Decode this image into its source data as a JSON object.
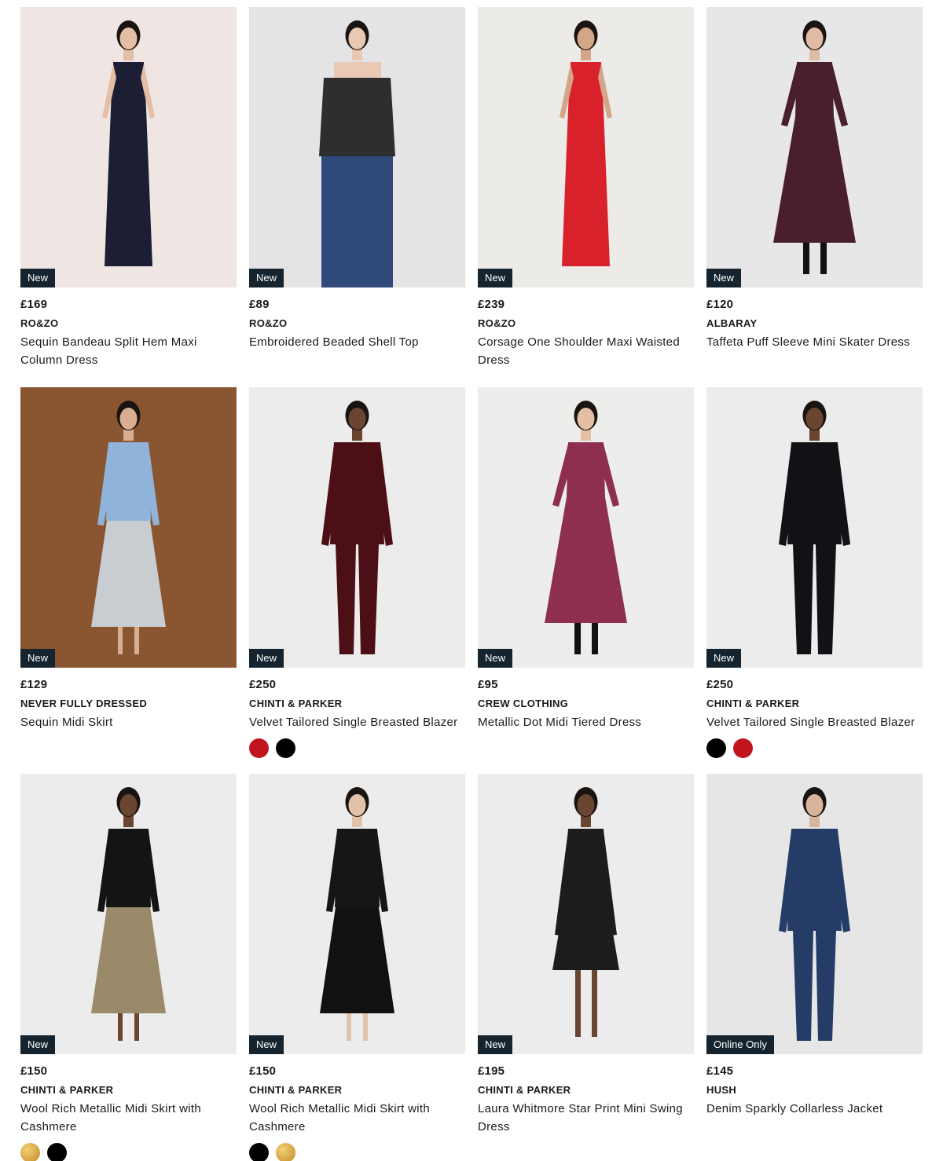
{
  "products": [
    {
      "badge": "New",
      "price": "£169",
      "brand": "RO&ZO",
      "title": "Sequin Bandeau Split Hem Maxi Column Dress",
      "bg": "#efe6e4",
      "garment": "#1c1e33",
      "skin": "#e5bea6",
      "style": "gown",
      "swatches": []
    },
    {
      "badge": "New",
      "price": "£89",
      "brand": "RO&ZO",
      "title": "Embroidered Beaded Shell Top",
      "bg": "#e4e4e6",
      "garment": "#2c2e30",
      "skin": "#eac9b4",
      "style": "top",
      "swatches": []
    },
    {
      "badge": "New",
      "price": "£239",
      "brand": "RO&ZO",
      "title": "Corsage One Shoulder Maxi Waisted Dress",
      "bg": "#ecebe8",
      "garment": "#d8212b",
      "skin": "#d4a688",
      "style": "gown",
      "swatches": []
    },
    {
      "badge": "New",
      "price": "£120",
      "brand": "ALBARAY",
      "title": "Taffeta Puff Sleeve Mini Skater Dress",
      "bg": "#e7e6e8",
      "garment": "#4a1f2c",
      "skin": "#e1bba3",
      "style": "dress",
      "swatches": []
    },
    {
      "badge": "New",
      "price": "£129",
      "brand": "NEVER FULLY DRESSED",
      "title": "Sequin Midi Skirt",
      "bg": "#8a5631",
      "garment": "#c8cdd2",
      "skin": "#d8ad91",
      "style": "skirt",
      "top": "#8fb3d9",
      "swatches": []
    },
    {
      "badge": "New",
      "price": "£250",
      "brand": "CHINTI & PARKER",
      "title": "Velvet Tailored Single Breasted Blazer",
      "bg": "#ececec",
      "garment": "#4c0f16",
      "skin": "#6a4632",
      "style": "suit",
      "swatches": [
        "#c0141f",
        "#000000"
      ]
    },
    {
      "badge": "New",
      "price": "£95",
      "brand": "CREW CLOTHING",
      "title": "Metallic Dot Midi Tiered Dress",
      "bg": "#ededeb",
      "garment": "#8e2f52",
      "skin": "#e4bfa5",
      "style": "dress",
      "swatches": []
    },
    {
      "badge": "New",
      "price": "£250",
      "brand": "CHINTI & PARKER",
      "title": "Velvet Tailored Single Breasted Blazer",
      "bg": "#ececec",
      "garment": "#121216",
      "skin": "#6a4632",
      "style": "suit",
      "swatches": [
        "#000000",
        "#c0141f"
      ]
    },
    {
      "badge": "New",
      "price": "£150",
      "brand": "CHINTI & PARKER",
      "title": "Wool Rich Metallic Midi Skirt with Cashmere",
      "bg": "#ececec",
      "garment": "#9b8a6a",
      "skin": "#6a4632",
      "style": "skirt",
      "top": "#141414",
      "swatches": [
        "#d4a23c",
        "#000000"
      ]
    },
    {
      "badge": "New",
      "price": "£150",
      "brand": "CHINTI & PARKER",
      "title": "Wool Rich Metallic Midi Skirt with Cashmere",
      "bg": "#ececec",
      "garment": "#111111",
      "skin": "#e3c2aa",
      "style": "skirt",
      "top": "#161616",
      "swatches": [
        "#000000",
        "#d4a23c"
      ]
    },
    {
      "badge": "New",
      "price": "£195",
      "brand": "CHINTI & PARKER",
      "title": "Laura Whitmore Star Print Mini Swing Dress",
      "bg": "#ececec",
      "garment": "#1c1c1a",
      "skin": "#6a4632",
      "style": "mini",
      "swatches": []
    },
    {
      "badge": "Online Only",
      "price": "£145",
      "brand": "HUSH",
      "title": "Denim Sparkly Collarless Jacket",
      "bg": "#e6e6e6",
      "garment": "#243c66",
      "skin": "#d8b49a",
      "style": "suit",
      "swatches": []
    }
  ]
}
